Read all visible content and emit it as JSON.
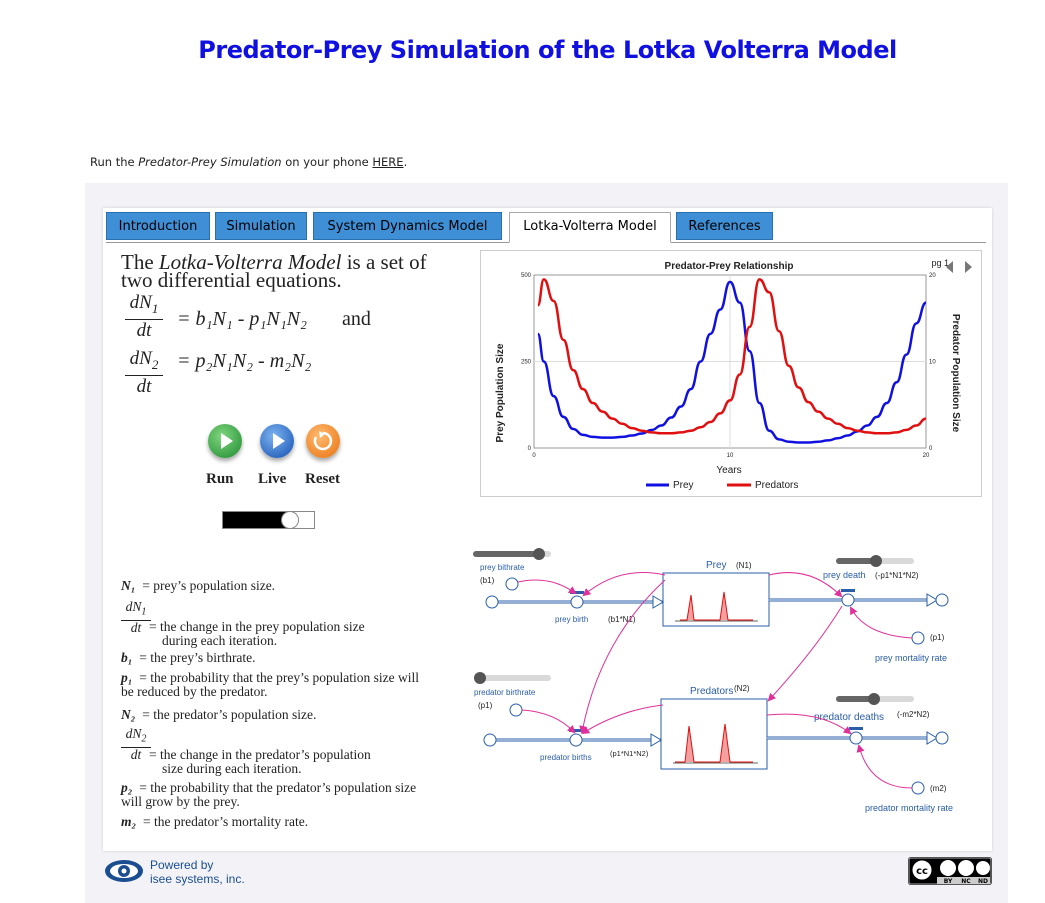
{
  "page": {
    "title": "Predator-Prey Simulation of the Lotka Volterra Model",
    "run_prefix": "Run the ",
    "run_italic": "Predator-Prey Simulation",
    "run_middle": " on your phone ",
    "run_link": "HERE",
    "run_suffix": "."
  },
  "tabs": [
    {
      "label": "Introduction"
    },
    {
      "label": "Simulation"
    },
    {
      "label": "System Dynamics Model"
    },
    {
      "label": "Lotka-Volterra Model",
      "active": true
    },
    {
      "label": "References"
    }
  ],
  "intro": {
    "line1_a": "The ",
    "line1_italic": "Lotka-Volterra Model",
    "line1_b": " is a set of",
    "line2": "two differential equations.",
    "and": "and"
  },
  "equations": {
    "eq1_num": "dN",
    "eq1_sub": "1",
    "eq1_den": "dt",
    "eq1_rhs": "= b₁N₁ - p₁N₁N₂",
    "eq2_num": "dN",
    "eq2_sub": "2",
    "eq2_den": "dt",
    "eq2_rhs": "= p₂N₁N₂ - m₂N₂"
  },
  "controls": {
    "run": "Run",
    "live": "Live",
    "reset": "Reset",
    "colors": {
      "run": "#2ea043",
      "live": "#1f6fd6",
      "reset": "#f07a1f"
    }
  },
  "definitions": [
    {
      "sym": "N₁",
      "text": "= prey’s population size."
    },
    {
      "sym": "dN₁/dt",
      "text": "= the change in the prey population size",
      "text2": "during each iteration."
    },
    {
      "sym": "b₁",
      "text": "= the prey’s birthrate."
    },
    {
      "sym": "p₁",
      "text": "= the probability that the prey’s population size will",
      "text2": "be reduced by the predator."
    },
    {
      "sym": "N₂",
      "text": "= the predator’s population size."
    },
    {
      "sym": "dN₂/dt",
      "text": "= the change in the predator’s population",
      "text2": "size during each iteration."
    },
    {
      "sym": "p₂",
      "text": "= the probability that the predator’s population size",
      "text2": "will grow by the prey."
    },
    {
      "sym": "m₂",
      "text": "= the predator’s mortality rate."
    }
  ],
  "chart_data": {
    "type": "line",
    "title": "Predator-Prey Relationship",
    "xlabel": "Years",
    "ylabel": "Prey Population Size",
    "ylabel_right": "Predator Population Size",
    "page_indicator": "pg 1",
    "xlim": [
      0,
      20
    ],
    "x_ticks": [
      "0",
      "10",
      "20"
    ],
    "ylim_left": [
      0,
      500
    ],
    "y_ticks_left": [
      "0",
      "250",
      "500"
    ],
    "ylim_right": [
      0,
      20
    ],
    "y_ticks_right": [
      "0",
      "10",
      "20"
    ],
    "legend_placement": "bottom",
    "series": [
      {
        "name": "Prey",
        "color": "#1010e0",
        "axis": "left",
        "x": [
          0.2,
          0.5,
          1,
          1.5,
          2,
          2.5,
          3,
          3.5,
          4,
          4.5,
          5,
          5.5,
          6,
          6.5,
          7,
          7.5,
          8,
          8.5,
          9,
          9.5,
          10,
          10.5,
          11,
          11.5,
          12,
          12.5,
          13,
          13.5,
          14,
          14.5,
          15,
          15.5,
          16,
          16.5,
          17,
          17.5,
          18,
          18.5,
          19,
          19.5,
          20
        ],
        "y": [
          330,
          250,
          150,
          90,
          55,
          38,
          32,
          30,
          30,
          32,
          36,
          42,
          52,
          65,
          88,
          120,
          170,
          250,
          330,
          400,
          480,
          420,
          280,
          130,
          50,
          25,
          18,
          16,
          16,
          18,
          22,
          28,
          36,
          48,
          65,
          90,
          130,
          190,
          270,
          360,
          420
        ]
      },
      {
        "name": "Predators",
        "color": "#e01010",
        "axis": "right",
        "x": [
          0.2,
          0.5,
          1,
          1.5,
          2,
          2.5,
          3,
          3.5,
          4,
          4.5,
          5,
          5.5,
          6,
          6.5,
          7,
          7.5,
          8,
          8.5,
          9,
          9.5,
          10,
          10.5,
          11,
          11.5,
          12,
          12.5,
          13,
          13.5,
          14,
          14.5,
          15,
          15.5,
          16,
          16.5,
          17,
          17.5,
          18,
          18.5,
          19,
          19.5,
          20
        ],
        "y": [
          16.5,
          19.5,
          17,
          12.5,
          9,
          6.8,
          5.2,
          4.2,
          3.4,
          2.8,
          2.3,
          2,
          1.8,
          1.7,
          1.7,
          1.8,
          2,
          2.4,
          3,
          4,
          5.5,
          8.5,
          14,
          19.5,
          18,
          13.5,
          9.5,
          7,
          5.3,
          4.2,
          3.4,
          2.8,
          2.3,
          2,
          1.8,
          1.7,
          1.7,
          1.8,
          2.1,
          2.6,
          3.4
        ]
      }
    ]
  },
  "sd_model": {
    "prey_bithrate": "prey bithrate",
    "b1": "(b1)",
    "prey_birth": "prey birth",
    "prey_birth_eq": "(b1*N1)",
    "prey": "Prey",
    "prey_n": "(N1)",
    "prey_death": "prey death",
    "prey_death_eq": "(-p1*N1*N2)",
    "p1": "(p1)",
    "prey_mortality": "prey mortality rate",
    "predator_birthrate": "predator birthrate",
    "pred_p1": "(p1)",
    "predators": "Predators",
    "predators_n": "(N2)",
    "predator_births": "predator births",
    "predator_births_eq": "(p1*N1*N2)",
    "predator_deaths": "predator deaths",
    "predator_deaths_eq": "(-m2*N2)",
    "m2": "(m2)",
    "predator_mortality": "predator mortality rate",
    "sliders": {
      "prey_bithrate": 0.85,
      "predator_birthrate": 0.0,
      "prey_death": 0.55,
      "predator_deaths": 0.5
    }
  },
  "footer": {
    "powered_line1": "Powered by",
    "powered_line2": "isee systems, inc.",
    "license": "cc BY NC ND",
    "license_cc": "cc",
    "license_by": "BY",
    "license_nc": "NC",
    "license_nd": "ND"
  }
}
